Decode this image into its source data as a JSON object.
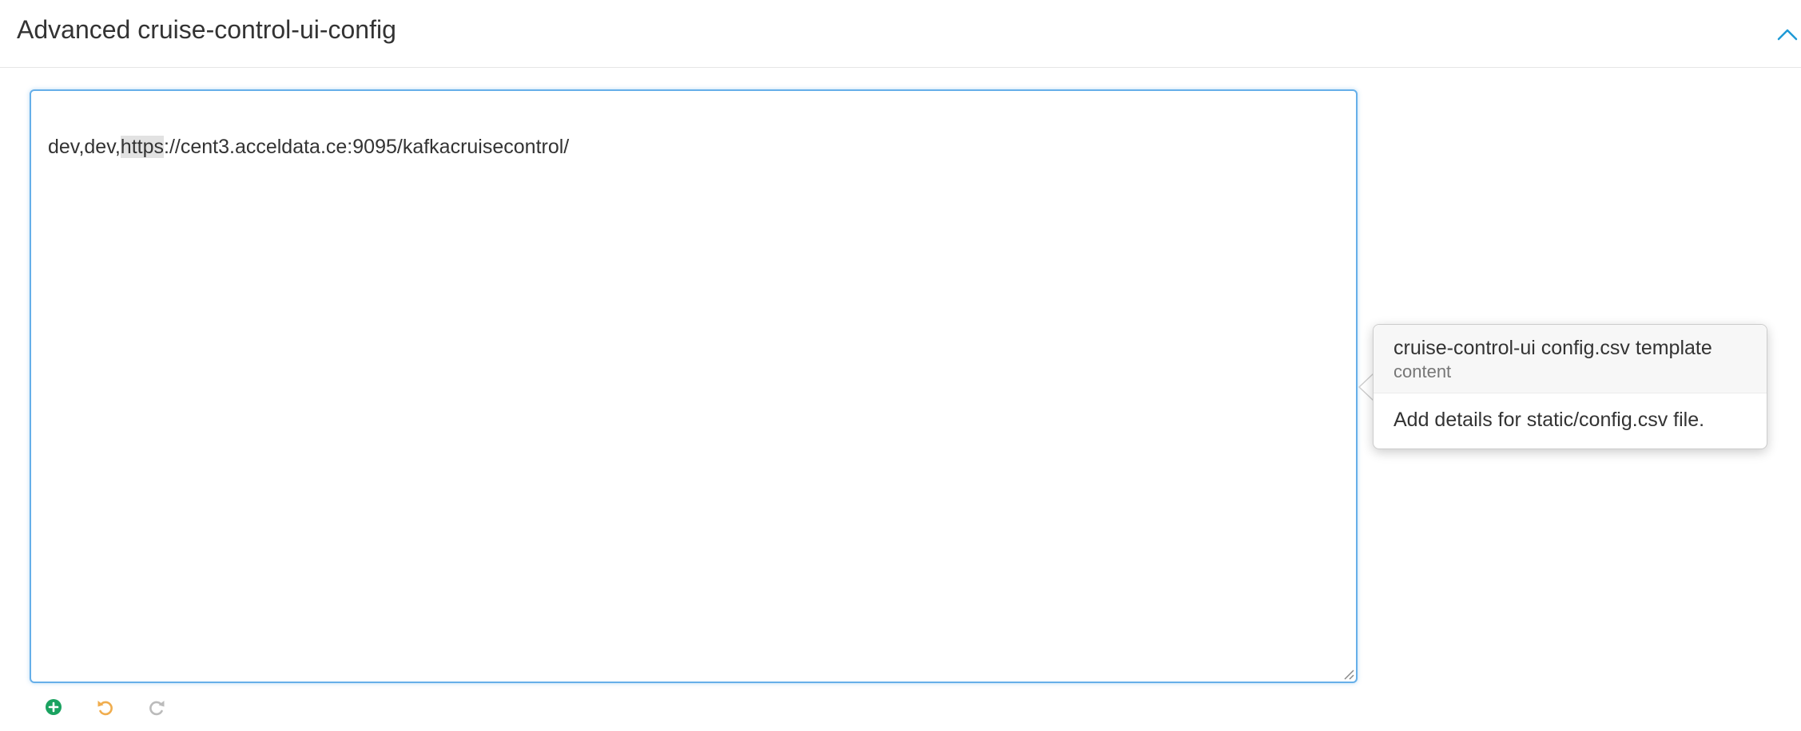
{
  "panel": {
    "title": "Advanced cruise-control-ui-config",
    "collapse_icon": "chevron-up-icon"
  },
  "editor": {
    "highlight_token": "https",
    "value_prefix": "dev,dev,",
    "value_suffix": "://cent3.acceldata.ce:9095/kafkacruisecontrol/"
  },
  "popover": {
    "title": "cruise-control-ui config.csv template",
    "subtitle": "content",
    "body": "Add details for static/config.csv file."
  },
  "actions": [
    {
      "name": "add-property",
      "icon": "plus-circle-icon"
    },
    {
      "name": "undo",
      "icon": "undo-icon"
    },
    {
      "name": "redo",
      "icon": "redo-icon"
    }
  ],
  "colors": {
    "accent": "#1f9ad6",
    "focus_border": "#66afe9",
    "add": "#1aa260",
    "undo": "#f0ad4e",
    "redo_disabled": "#bbbbbb"
  }
}
